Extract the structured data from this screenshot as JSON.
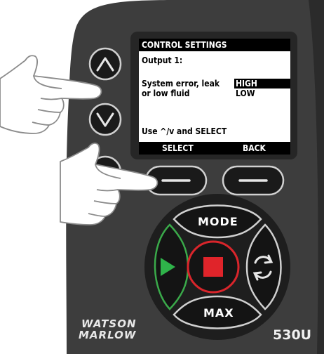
{
  "screen": {
    "title": "CONTROL SETTINGS",
    "output_label": "Output 1:",
    "condition_line1": "System error, leak",
    "condition_line2": "or low fluid",
    "option_selected": "HIGH",
    "option_other": "LOW",
    "instruction": "Use ^/v and SELECT",
    "softkey_left": "SELECT",
    "softkey_right": "BACK"
  },
  "keypad": {
    "up_icon": "chevron-up-icon",
    "down_icon": "chevron-down-icon",
    "mode_label": "MODE",
    "max_label": "MAX",
    "play_icon": "play-icon",
    "stop_icon": "stop-icon",
    "reverse_icon": "rotate-arrows-icon"
  },
  "branding": {
    "brand_line1": "WATSON",
    "brand_line2": "MARLOW",
    "model": "530U"
  },
  "colors": {
    "housing": "#3c3c3c",
    "bezel": "#262626",
    "accent_green": "#1f9a3a",
    "accent_red": "#d9252b"
  }
}
